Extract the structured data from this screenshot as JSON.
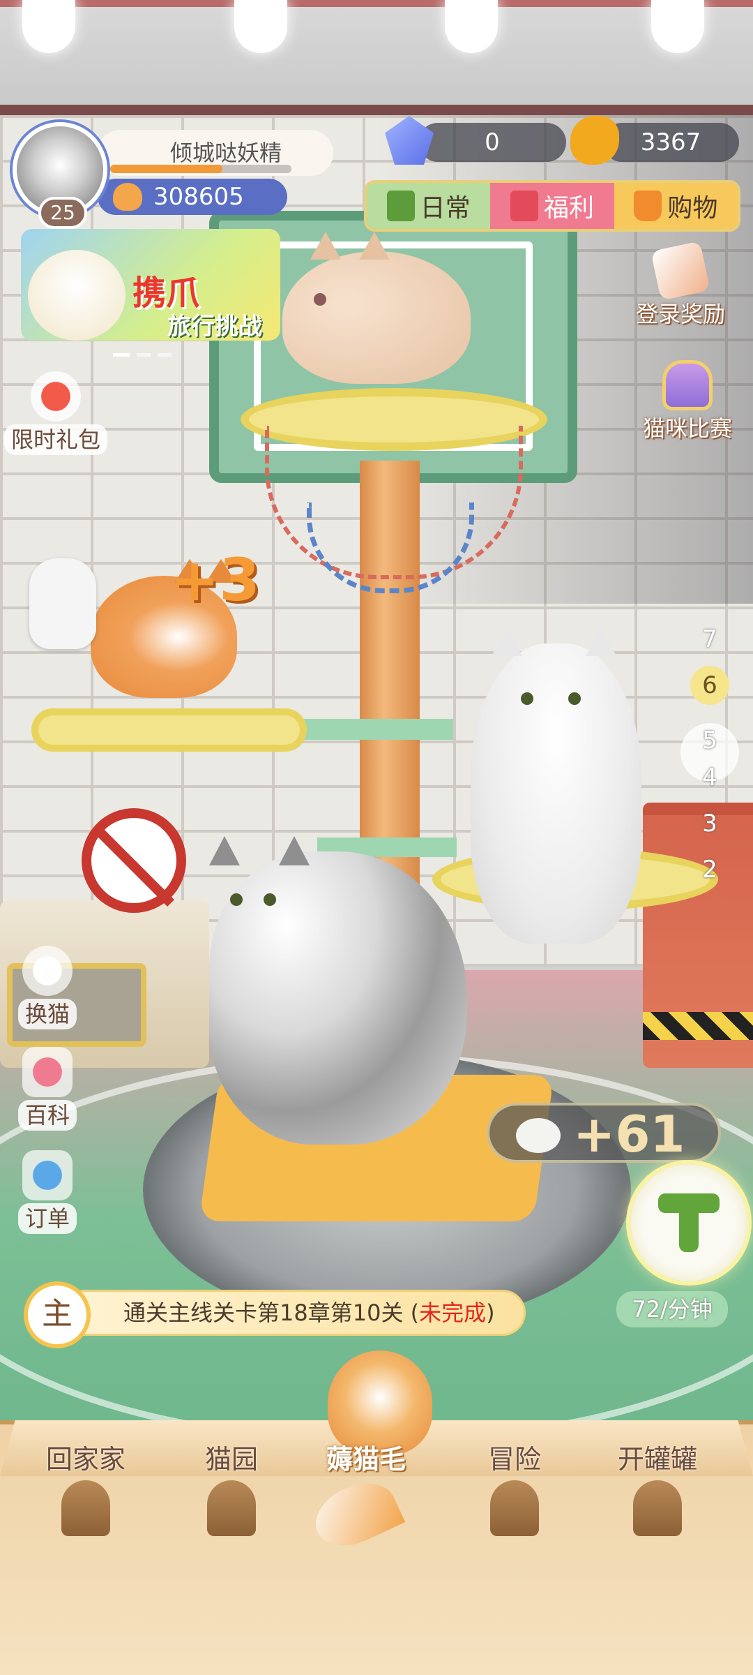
{
  "player": {
    "name": "倾城哒妖精",
    "level": "25",
    "coins": "308605",
    "xp_fraction": 0.62
  },
  "resources": {
    "gems": "0",
    "fish": "3367"
  },
  "top_tabs": [
    {
      "label": "日常",
      "icon": "checklist-icon"
    },
    {
      "label": "福利",
      "icon": "gift-icon"
    },
    {
      "label": "购物",
      "icon": "basket-icon"
    }
  ],
  "event_banner": {
    "title": "携爪",
    "subtitle": "旅行挑战"
  },
  "left_menu": {
    "limited_gift": "限时礼包",
    "swap_cat": "换猫",
    "encyclopedia": "百科",
    "orders": "订单"
  },
  "right_menu": {
    "login_reward": "登录奖励",
    "cat_contest": "猫咪比赛"
  },
  "floating_bonus": "+3",
  "floors": [
    "7",
    "6",
    "5",
    "4",
    "3",
    "2"
  ],
  "active_floor": "6",
  "fur": {
    "amount": "+61",
    "rate": "72/分钟"
  },
  "quest": {
    "badge": "主",
    "text": "通关主线关卡第18章第10关 (",
    "status": "未完成",
    "close": ")"
  },
  "bottom_nav": [
    {
      "label": "回家家"
    },
    {
      "label": "猫园"
    },
    {
      "label": "薅猫毛",
      "active": true
    },
    {
      "label": "冒险"
    },
    {
      "label": "开罐罐"
    }
  ],
  "colors": {
    "accent_orange": "#f29a38",
    "coin_pill": "#5a6fc4",
    "quest_red": "#e3261d"
  }
}
